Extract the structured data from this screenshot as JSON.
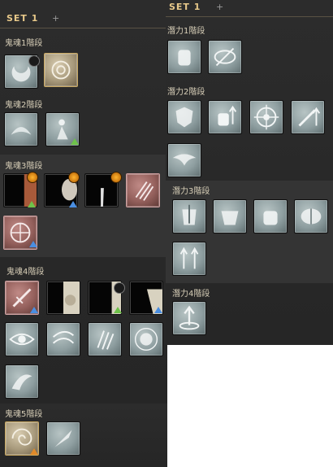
{
  "left_panel": {
    "set_label": "SET 1",
    "plus": "+",
    "tiers": [
      {
        "label": "鬼魂1階段"
      },
      {
        "label": "鬼魂2階段"
      },
      {
        "label": "鬼魂3階段"
      },
      {
        "label": "鬼魂4階段"
      },
      {
        "label": "鬼魂5階段"
      }
    ]
  },
  "right_panel": {
    "set_label": "SET 1",
    "plus": "+",
    "tiers": [
      {
        "label": "潛力1階段"
      },
      {
        "label": "潛力2階段"
      },
      {
        "label": "潛力3階段"
      },
      {
        "label": "潛力4階段"
      }
    ]
  },
  "icons": {
    "ghost1": [
      "crescent-moon-icon",
      "spiral-rune-icon"
    ],
    "ghost2": [
      "flame-wreath-icon",
      "spirit-figure-icon"
    ],
    "ghost3": [
      "dark-portrait-icon",
      "dark-face-icon",
      "dark-silhouette-icon",
      "claw-slash-icon",
      "rune-wheel-icon"
    ],
    "ghost4": [
      "sword-strike-icon",
      "moon-phase-icon",
      "black-hand-icon",
      "dark-half-icon",
      "eye-icon",
      "wind-swirl-icon",
      "claw-marks-icon",
      "sun-wreath-icon",
      "spirit-burst-icon"
    ],
    "ghost5": [
      "vortex-icon",
      "feather-blade-icon"
    ],
    "potential1": [
      "fist-icon",
      "eye-slash-icon"
    ],
    "potential2": [
      "shield-up-icon",
      "fist-up-icon",
      "target-icon",
      "sword-up-icon",
      "eagle-icon"
    ],
    "potential3": [
      "armor-up-icon",
      "armor-grip-icon",
      "fist-grip-icon",
      "brain-icon",
      "arrows-up-icon"
    ],
    "potential4": [
      "fountain-up-icon"
    ]
  },
  "colors": {
    "panel_bg": "#2a2a2a",
    "header_gold": "#e8c98a",
    "icon_steel": "#8e9ea0",
    "upgrade_green": "#6ec24a",
    "upgrade_blue": "#4a8ee0",
    "upgrade_orange": "#e08a2a"
  }
}
